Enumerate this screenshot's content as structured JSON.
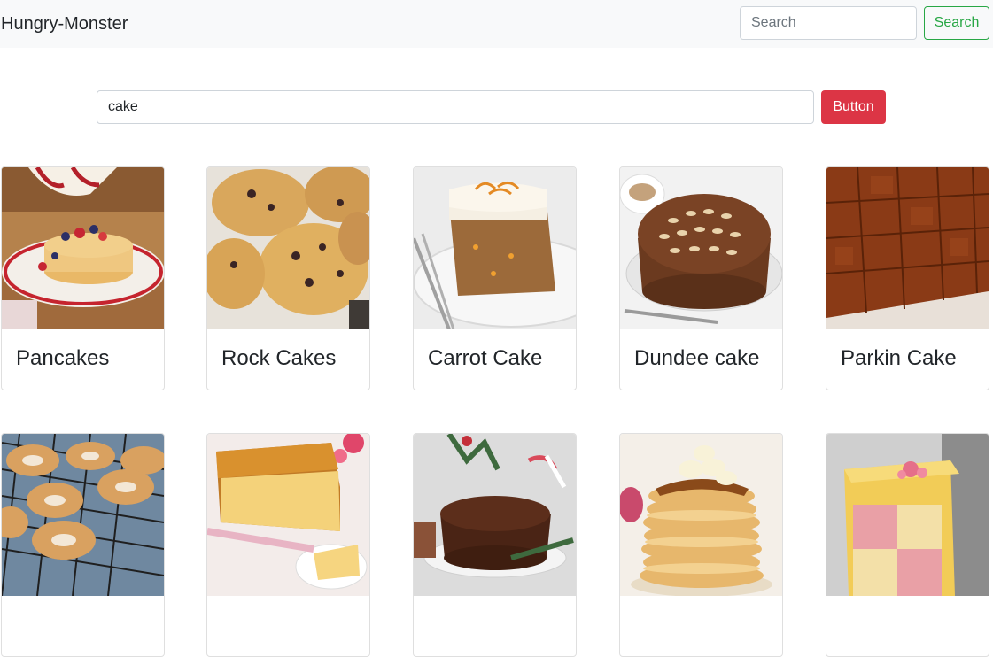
{
  "navbar": {
    "brand": "Hungry-Monster",
    "search_placeholder": "Search",
    "search_button": "Search"
  },
  "main_search": {
    "value": "cake",
    "button": "Button"
  },
  "colors": {
    "navbar_bg": "#f8f9fa",
    "outline_success": "#28a745",
    "danger": "#dc3545"
  },
  "meals": [
    {
      "name": "Pancakes"
    },
    {
      "name": "Rock Cakes"
    },
    {
      "name": "Carrot Cake"
    },
    {
      "name": "Dundee cake"
    },
    {
      "name": "Parkin Cake"
    },
    {
      "name": ""
    },
    {
      "name": ""
    },
    {
      "name": ""
    },
    {
      "name": ""
    },
    {
      "name": ""
    }
  ]
}
